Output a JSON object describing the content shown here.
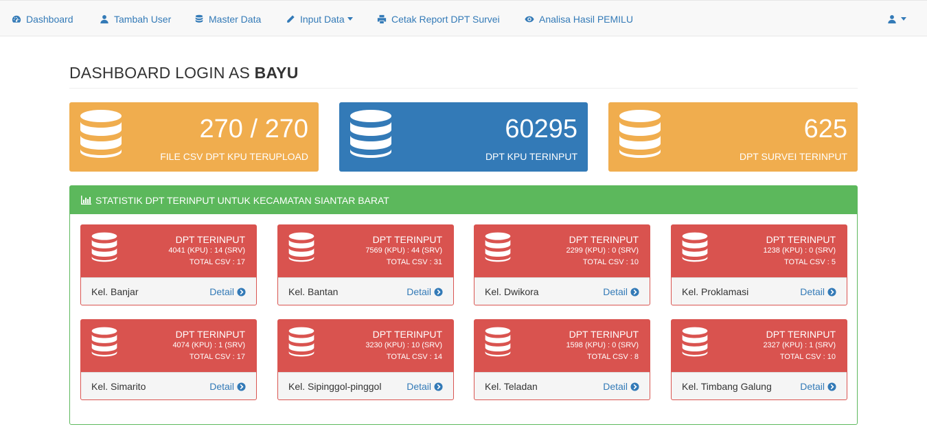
{
  "nav": {
    "items": [
      {
        "label": "Dashboard",
        "icon": "dashboard-icon"
      },
      {
        "label": "Tambah User",
        "icon": "user-icon"
      },
      {
        "label": "Master Data",
        "icon": "database-icon"
      },
      {
        "label": "Input Data",
        "icon": "pencil-icon"
      },
      {
        "label": "Cetak Report DPT Survei",
        "icon": "print-icon"
      },
      {
        "label": "Analisa Hasil PEMILU",
        "icon": "eye-icon"
      }
    ],
    "user_icon": "user-icon"
  },
  "header": {
    "prefix": "DASHBOARD LOGIN AS ",
    "username": "BAYU"
  },
  "stats": [
    {
      "value": "270 / 270",
      "label": "FILE CSV DPT KPU TERUPLOAD",
      "color": "#f0ad4e"
    },
    {
      "value": "60295",
      "label": "DPT KPU TERINPUT",
      "color": "#337ab7"
    },
    {
      "value": "625",
      "label": "DPT SURVEI TERINPUT",
      "color": "#f0ad4e"
    }
  ],
  "panel": {
    "title": "STATISTIK DPT TERINPUT UNTUK KECAMATAN SIANTAR BARAT",
    "color": "#5cb85c"
  },
  "kelurahan": [
    {
      "title": "DPT TERINPUT",
      "counts": "4041 (KPU) : 14 (SRV)",
      "csv": "TOTAL CSV : 17",
      "name": "Kel. Banjar",
      "detail": "Detail"
    },
    {
      "title": "DPT TERINPUT",
      "counts": "7569 (KPU) : 44 (SRV)",
      "csv": "TOTAL CSV : 31",
      "name": "Kel. Bantan",
      "detail": "Detail"
    },
    {
      "title": "DPT TERINPUT",
      "counts": "2299 (KPU) : 0 (SRV)",
      "csv": "TOTAL CSV : 10",
      "name": "Kel. Dwikora",
      "detail": "Detail"
    },
    {
      "title": "DPT TERINPUT",
      "counts": "1238 (KPU) : 0 (SRV)",
      "csv": "TOTAL CSV : 5",
      "name": "Kel. Proklamasi",
      "detail": "Detail"
    },
    {
      "title": "DPT TERINPUT",
      "counts": "4074 (KPU) : 1 (SRV)",
      "csv": "TOTAL CSV : 17",
      "name": "Kel. Simarito",
      "detail": "Detail"
    },
    {
      "title": "DPT TERINPUT",
      "counts": "3230 (KPU) : 10 (SRV)",
      "csv": "TOTAL CSV : 14",
      "name": "Kel. Sipinggol-pinggol",
      "detail": "Detail"
    },
    {
      "title": "DPT TERINPUT",
      "counts": "1598 (KPU) : 0 (SRV)",
      "csv": "TOTAL CSV : 8",
      "name": "Kel. Teladan",
      "detail": "Detail"
    },
    {
      "title": "DPT TERINPUT",
      "counts": "2327 (KPU) : 1 (SRV)",
      "csv": "TOTAL CSV : 10",
      "name": "Kel. Timbang Galung",
      "detail": "Detail"
    }
  ],
  "colors": {
    "danger": "#d9534f",
    "link": "#337ab7"
  }
}
